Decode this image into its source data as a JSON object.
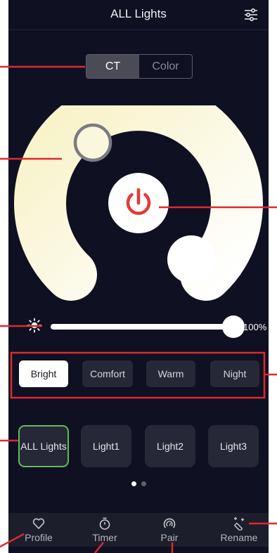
{
  "header": {
    "title": "ALL Lights",
    "settings_icon": "sliders-icon"
  },
  "mode_tabs": [
    {
      "label": "CT",
      "selected": true
    },
    {
      "label": "Color",
      "selected": false
    }
  ],
  "power": {
    "icon": "power-icon",
    "color": "#e53935"
  },
  "brightness": {
    "icon": "sun-icon",
    "value": 100,
    "value_label": "100%"
  },
  "scenes": [
    {
      "label": "Bright",
      "selected": true
    },
    {
      "label": "Comfort",
      "selected": false
    },
    {
      "label": "Warm",
      "selected": false
    },
    {
      "label": "Night",
      "selected": false
    }
  ],
  "groups": [
    {
      "label": "ALL Lights",
      "selected": true
    },
    {
      "label": "Light1",
      "selected": false
    },
    {
      "label": "Light2",
      "selected": false
    },
    {
      "label": "Light3",
      "selected": false
    }
  ],
  "page_indicator": {
    "count": 2,
    "active": 0
  },
  "tabbar": [
    {
      "label": "Profile",
      "icon": "heart-icon"
    },
    {
      "label": "Timer",
      "icon": "stopwatch-icon"
    },
    {
      "label": "Pair",
      "icon": "gauge-icon"
    },
    {
      "label": "Rename",
      "icon": "magic-wand-icon"
    }
  ],
  "colors": {
    "background": "#0f1022",
    "accent_green": "#5fbd58",
    "annotation_red": "#e0282e",
    "warm_white": "#f5f0c8"
  }
}
